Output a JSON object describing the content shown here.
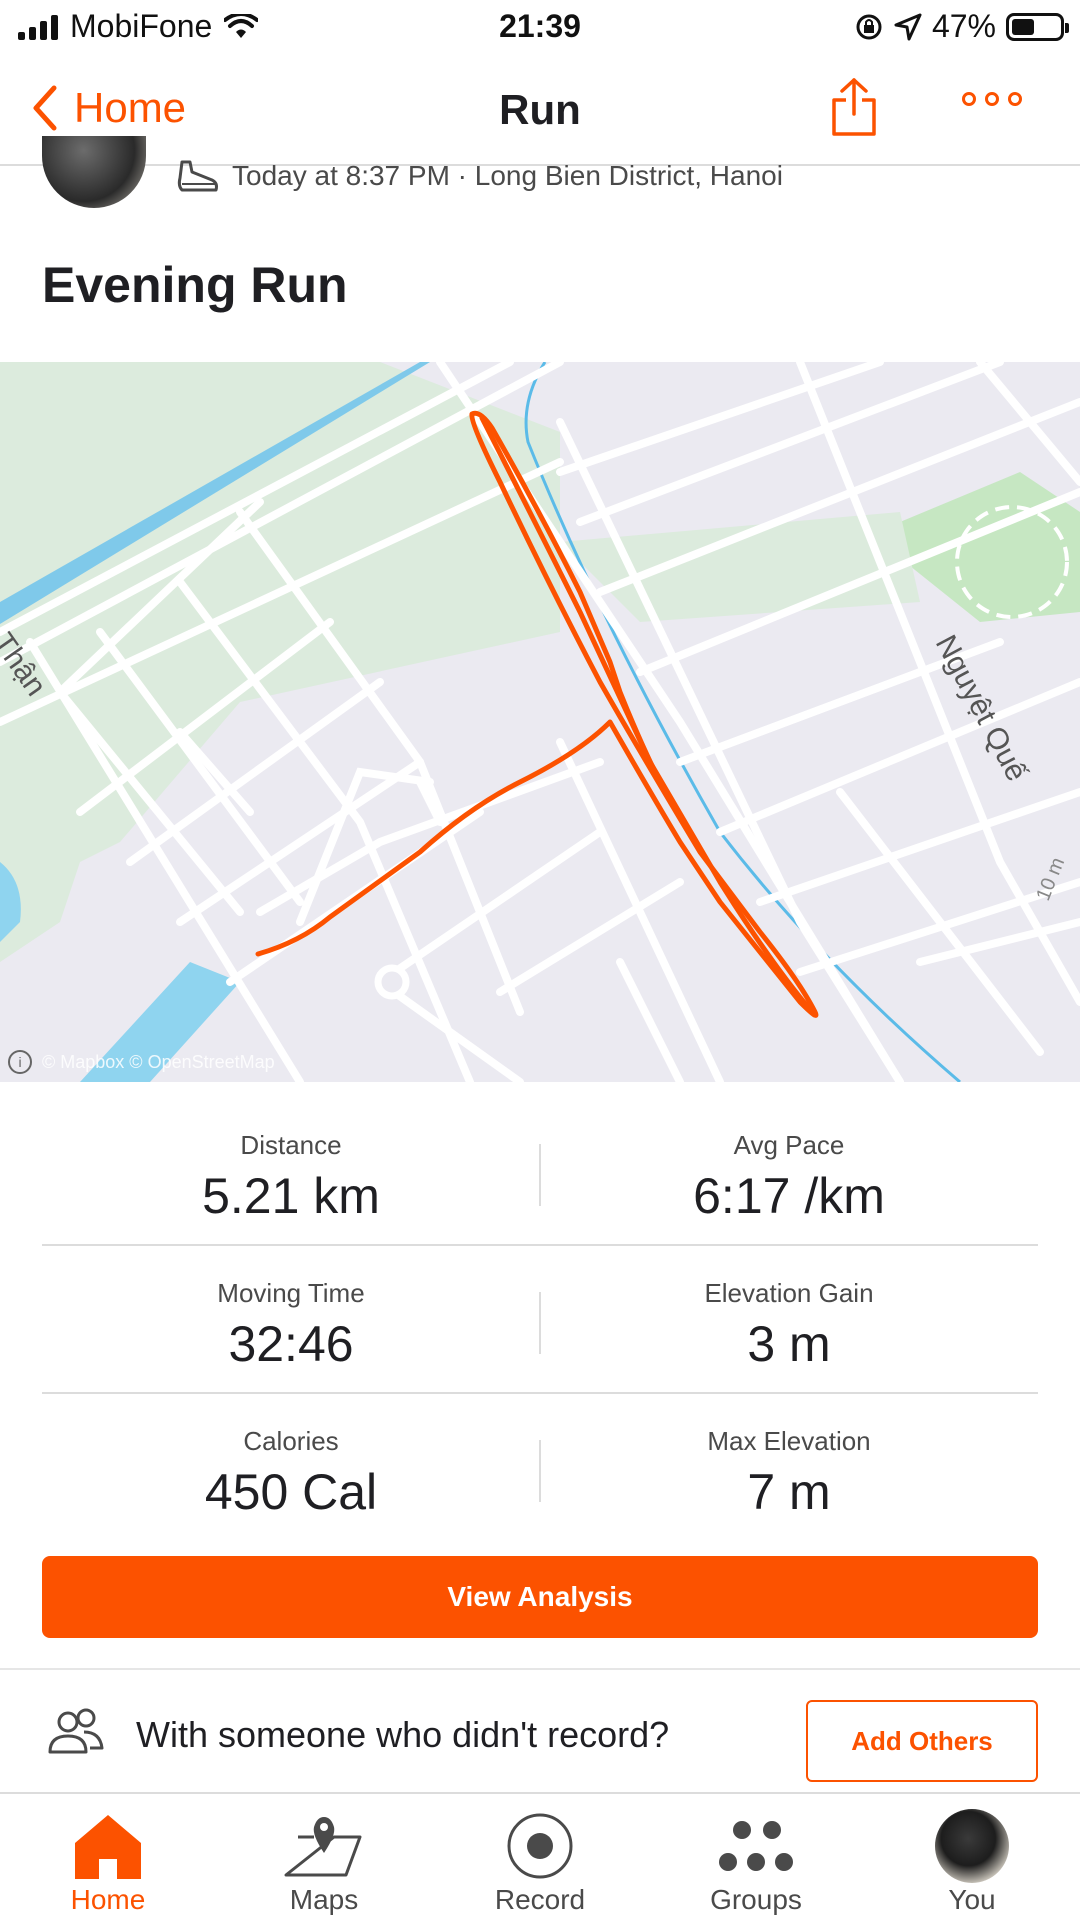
{
  "status_bar": {
    "carrier": "MobiFone",
    "time": "21:39",
    "battery_percent": "47%",
    "battery_level": 0.47
  },
  "nav": {
    "back_label": "Home",
    "title": "Run"
  },
  "activity": {
    "meta": "Today at 8:37 PM · Long Bien District, Hanoi",
    "title": "Evening Run"
  },
  "map": {
    "labels": {
      "street_left": "Thận",
      "street_right": "Nguyệt Quế",
      "contour": "10 m"
    },
    "attribution": "© Mapbox © OpenStreetMap",
    "colors": {
      "land": "#ebeaf1",
      "park": "#dcebdd",
      "park_strong": "#c6e7c2",
      "road": "#ffffff",
      "water": "#8fd4ef",
      "canal": "#5bbbe8",
      "route": "#fc5200"
    }
  },
  "stats": [
    {
      "left": {
        "label": "Distance",
        "value": "5.21 km"
      },
      "right": {
        "label": "Avg Pace",
        "value": "6:17 /km"
      }
    },
    {
      "left": {
        "label": "Moving Time",
        "value": "32:46"
      },
      "right": {
        "label": "Elevation Gain",
        "value": "3 m"
      }
    },
    {
      "left": {
        "label": "Calories",
        "value": "450 Cal"
      },
      "right": {
        "label": "Max Elevation",
        "value": "7 m"
      }
    }
  ],
  "buttons": {
    "view_analysis": "View Analysis",
    "add_others": "Add Others"
  },
  "with_others": {
    "text": "With someone who didn't record?"
  },
  "tabs": [
    {
      "label": "Home",
      "icon": "home-icon",
      "active": true
    },
    {
      "label": "Maps",
      "icon": "map-icon",
      "active": false
    },
    {
      "label": "Record",
      "icon": "record-icon",
      "active": false
    },
    {
      "label": "Groups",
      "icon": "groups-icon",
      "active": false
    },
    {
      "label": "You",
      "icon": "avatar",
      "active": false
    }
  ],
  "colors": {
    "accent": "#fc5200",
    "text": "#1f1f23",
    "muted": "#4a4a4a",
    "divider": "#dcdcdc"
  }
}
